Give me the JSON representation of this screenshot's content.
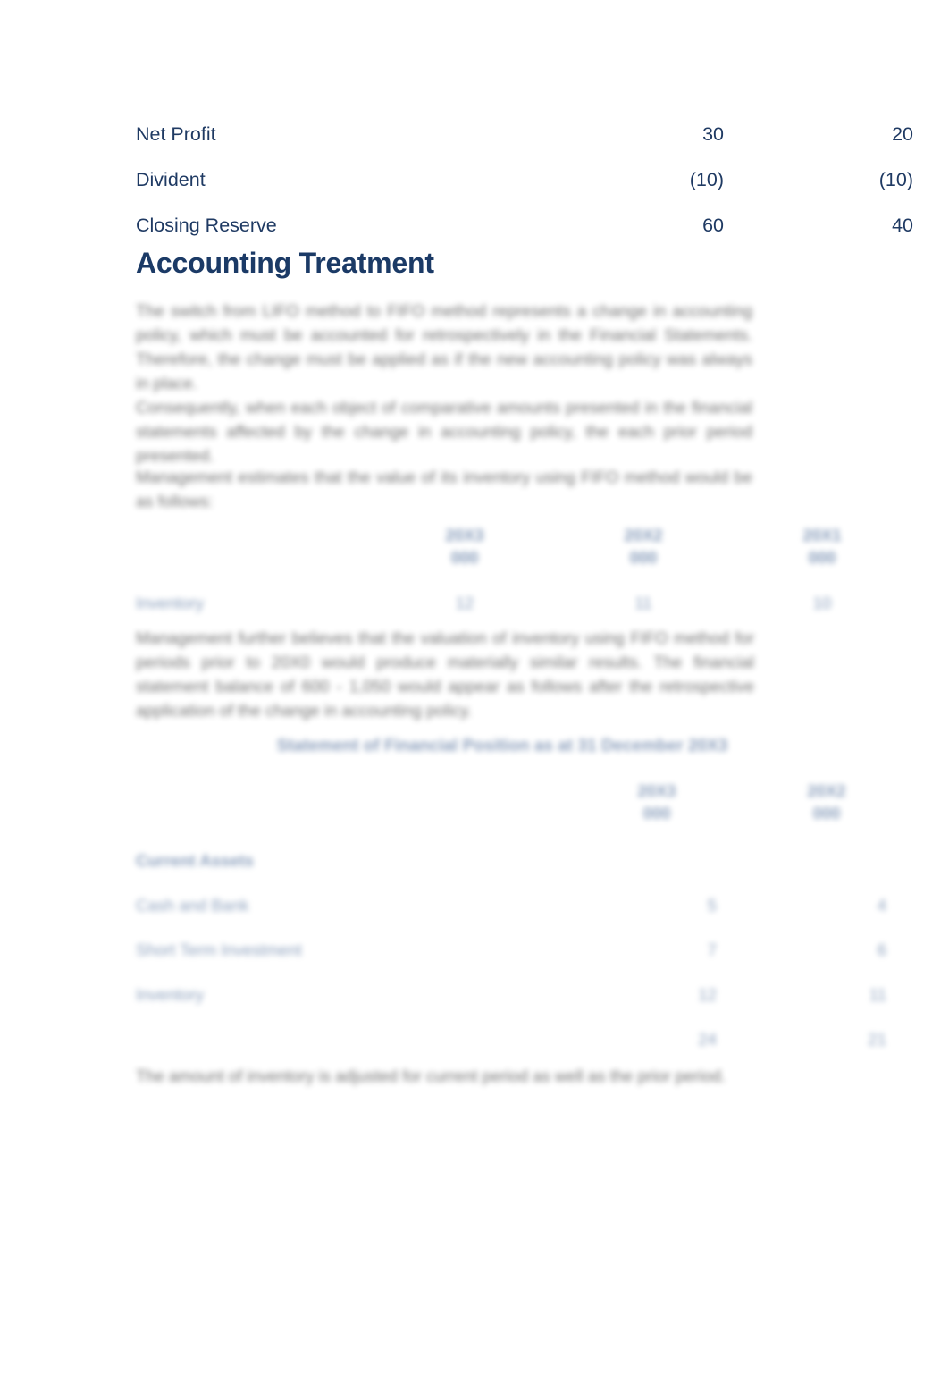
{
  "document": {
    "colors": {
      "text_navy": "#1f3a63",
      "heading_navy": "#1b3a66",
      "table_blue": "#2f5387",
      "body_gray": "#3c3c3c",
      "background": "#ffffff"
    }
  },
  "reserves_table": {
    "rows": [
      {
        "label": "Net Profit",
        "col1": "30",
        "col2": "20"
      },
      {
        "label": "Divident",
        "col1": "(10)",
        "col2": "(10)"
      },
      {
        "label": "Closing Reserve",
        "col1": "60",
        "col2": "40"
      }
    ]
  },
  "heading": {
    "title": "Accounting Treatment"
  },
  "paragraphs": {
    "p1": "The switch from LIFO method to FIFO method represents a change in accounting policy, which must be accounted for retrospectively in the Financial Statements. Therefore, the change must be applied as if the new accounting policy was always in place.",
    "p2": "Consequently, when each object of comparative amounts presented in the financial statements affected by the change in accounting policy, the each prior period presented.",
    "p3": "Management estimates that the value of its inventory using FIFO method would be as follows:",
    "p4": "Management further believes that the valuation of inventory using FIFO method for periods prior to 20X0 would produce materially similar results. The financial statement balance of 600 - 1,050 would appear as follows after the retrospective application of the change in accounting policy.",
    "p5": "The amount of inventory is adjusted for current period as well as the prior period."
  },
  "inventory_table": {
    "columns": [
      {
        "line1": "20X3",
        "line2": "000"
      },
      {
        "line1": "20X2",
        "line2": "000"
      },
      {
        "line1": "20X1",
        "line2": "000"
      }
    ],
    "rows": [
      {
        "label": "Inventory",
        "values": [
          "12",
          "11",
          "10"
        ]
      }
    ]
  },
  "sfp": {
    "title": "Statement of Financial Position as at 31 December 20X3",
    "columns": [
      {
        "line1": "20X3",
        "line2": "000"
      },
      {
        "line1": "20X2",
        "line2": "000"
      }
    ],
    "rows": [
      {
        "label": "Current Assets",
        "group": true,
        "values": [
          "",
          ""
        ]
      },
      {
        "label": "Cash and Bank",
        "group": false,
        "values": [
          "5",
          "4"
        ]
      },
      {
        "label": "Short Term Investment",
        "group": false,
        "values": [
          "7",
          "6"
        ]
      },
      {
        "label": "Inventory",
        "group": false,
        "values": [
          "12",
          "11"
        ]
      },
      {
        "label": "",
        "group": false,
        "values": [
          "24",
          "21"
        ]
      }
    ]
  }
}
